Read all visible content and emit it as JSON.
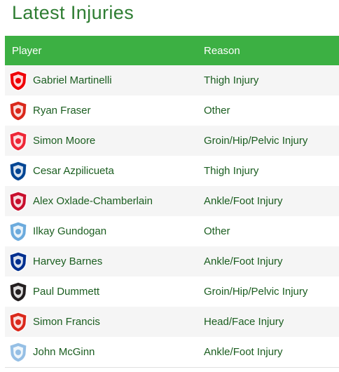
{
  "page": {
    "title": "Latest Injuries"
  },
  "table": {
    "headers": {
      "player": "Player",
      "reason": "Reason"
    },
    "rows": [
      {
        "player": "Gabriel Martinelli",
        "reason": "Thigh Injury",
        "crest": "arsenal-crest-icon",
        "crest_color": "#ef0107"
      },
      {
        "player": "Ryan Fraser",
        "reason": "Other",
        "crest": "bournemouth-crest-icon",
        "crest_color": "#da291c"
      },
      {
        "player": "Simon Moore",
        "reason": "Groin/Hip/Pelvic Injury",
        "crest": "sheffield-united-crest-icon",
        "crest_color": "#ee2737"
      },
      {
        "player": "Cesar Azpilicueta",
        "reason": "Thigh Injury",
        "crest": "chelsea-crest-icon",
        "crest_color": "#034694"
      },
      {
        "player": "Alex Oxlade-Chamberlain",
        "reason": "Ankle/Foot Injury",
        "crest": "liverpool-crest-icon",
        "crest_color": "#c8102e"
      },
      {
        "player": "Ilkay Gundogan",
        "reason": "Other",
        "crest": "manchester-city-crest-icon",
        "crest_color": "#6cabdd"
      },
      {
        "player": "Harvey Barnes",
        "reason": "Ankle/Foot Injury",
        "crest": "leicester-city-crest-icon",
        "crest_color": "#003090"
      },
      {
        "player": "Paul Dummett",
        "reason": "Groin/Hip/Pelvic Injury",
        "crest": "newcastle-crest-icon",
        "crest_color": "#241f20"
      },
      {
        "player": "Simon Francis",
        "reason": "Head/Face Injury",
        "crest": "bournemouth-crest-icon",
        "crest_color": "#da291c"
      },
      {
        "player": "John McGinn",
        "reason": "Ankle/Foot Injury",
        "crest": "aston-villa-crest-icon",
        "crest_color": "#95bfe5"
      }
    ]
  }
}
